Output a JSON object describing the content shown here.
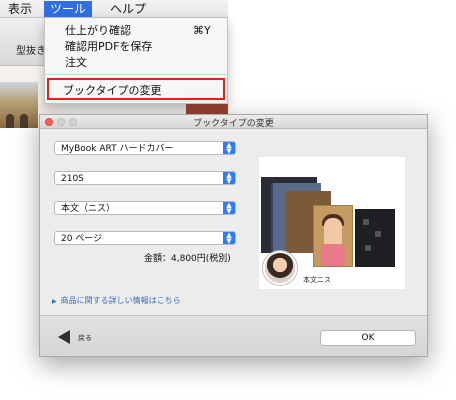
{
  "menubar": {
    "items": [
      {
        "label": "表示"
      },
      {
        "label": "ツール",
        "active": true
      },
      {
        "label": "ヘルプ"
      }
    ]
  },
  "toolbar": {
    "label": "型抜き"
  },
  "menu": {
    "items": [
      {
        "label": "仕上がり確認",
        "shortcut": "⌘Y"
      },
      {
        "label": "確認用PDFを保存",
        "shortcut": ""
      },
      {
        "label": "注文",
        "shortcut": ""
      }
    ],
    "highlighted_item": "ブックタイプの変更",
    "highlight_color": "#e3221b"
  },
  "dialog": {
    "title": "ブックタイプの変更",
    "selects": [
      {
        "value": "MyBook ART ハードカバー"
      },
      {
        "value": "210S"
      },
      {
        "value": "本文（ニス）"
      },
      {
        "value": "20 ページ"
      }
    ],
    "price_label": "金額：4,800円(税別)",
    "more_info": "商品に関する詳しい情報はこちら",
    "preview_caption": "本文ニス",
    "back_label": "戻る",
    "ok_label": "OK",
    "accent_color": "#2f7cf6",
    "link_color": "#3b6fb8"
  }
}
